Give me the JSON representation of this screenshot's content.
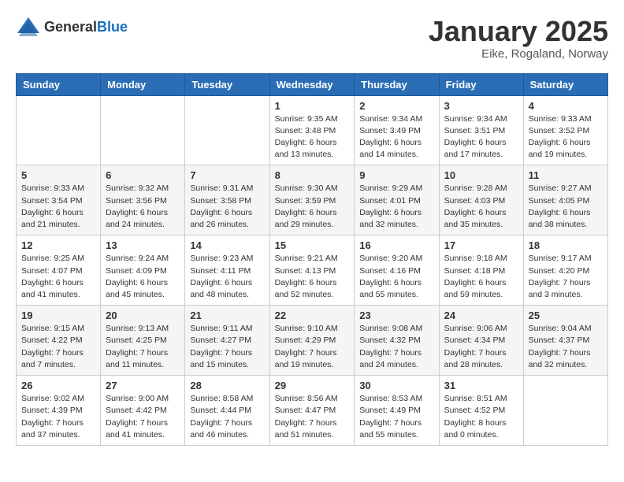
{
  "logo": {
    "general": "General",
    "blue": "Blue"
  },
  "title": {
    "month": "January 2025",
    "location": "Eike, Rogaland, Norway"
  },
  "headers": [
    "Sunday",
    "Monday",
    "Tuesday",
    "Wednesday",
    "Thursday",
    "Friday",
    "Saturday"
  ],
  "weeks": [
    [
      {
        "day": "",
        "info": ""
      },
      {
        "day": "",
        "info": ""
      },
      {
        "day": "",
        "info": ""
      },
      {
        "day": "1",
        "info": "Sunrise: 9:35 AM\nSunset: 3:48 PM\nDaylight: 6 hours\nand 13 minutes."
      },
      {
        "day": "2",
        "info": "Sunrise: 9:34 AM\nSunset: 3:49 PM\nDaylight: 6 hours\nand 14 minutes."
      },
      {
        "day": "3",
        "info": "Sunrise: 9:34 AM\nSunset: 3:51 PM\nDaylight: 6 hours\nand 17 minutes."
      },
      {
        "day": "4",
        "info": "Sunrise: 9:33 AM\nSunset: 3:52 PM\nDaylight: 6 hours\nand 19 minutes."
      }
    ],
    [
      {
        "day": "5",
        "info": "Sunrise: 9:33 AM\nSunset: 3:54 PM\nDaylight: 6 hours\nand 21 minutes."
      },
      {
        "day": "6",
        "info": "Sunrise: 9:32 AM\nSunset: 3:56 PM\nDaylight: 6 hours\nand 24 minutes."
      },
      {
        "day": "7",
        "info": "Sunrise: 9:31 AM\nSunset: 3:58 PM\nDaylight: 6 hours\nand 26 minutes."
      },
      {
        "day": "8",
        "info": "Sunrise: 9:30 AM\nSunset: 3:59 PM\nDaylight: 6 hours\nand 29 minutes."
      },
      {
        "day": "9",
        "info": "Sunrise: 9:29 AM\nSunset: 4:01 PM\nDaylight: 6 hours\nand 32 minutes."
      },
      {
        "day": "10",
        "info": "Sunrise: 9:28 AM\nSunset: 4:03 PM\nDaylight: 6 hours\nand 35 minutes."
      },
      {
        "day": "11",
        "info": "Sunrise: 9:27 AM\nSunset: 4:05 PM\nDaylight: 6 hours\nand 38 minutes."
      }
    ],
    [
      {
        "day": "12",
        "info": "Sunrise: 9:25 AM\nSunset: 4:07 PM\nDaylight: 6 hours\nand 41 minutes."
      },
      {
        "day": "13",
        "info": "Sunrise: 9:24 AM\nSunset: 4:09 PM\nDaylight: 6 hours\nand 45 minutes."
      },
      {
        "day": "14",
        "info": "Sunrise: 9:23 AM\nSunset: 4:11 PM\nDaylight: 6 hours\nand 48 minutes."
      },
      {
        "day": "15",
        "info": "Sunrise: 9:21 AM\nSunset: 4:13 PM\nDaylight: 6 hours\nand 52 minutes."
      },
      {
        "day": "16",
        "info": "Sunrise: 9:20 AM\nSunset: 4:16 PM\nDaylight: 6 hours\nand 55 minutes."
      },
      {
        "day": "17",
        "info": "Sunrise: 9:18 AM\nSunset: 4:18 PM\nDaylight: 6 hours\nand 59 minutes."
      },
      {
        "day": "18",
        "info": "Sunrise: 9:17 AM\nSunset: 4:20 PM\nDaylight: 7 hours\nand 3 minutes."
      }
    ],
    [
      {
        "day": "19",
        "info": "Sunrise: 9:15 AM\nSunset: 4:22 PM\nDaylight: 7 hours\nand 7 minutes."
      },
      {
        "day": "20",
        "info": "Sunrise: 9:13 AM\nSunset: 4:25 PM\nDaylight: 7 hours\nand 11 minutes."
      },
      {
        "day": "21",
        "info": "Sunrise: 9:11 AM\nSunset: 4:27 PM\nDaylight: 7 hours\nand 15 minutes."
      },
      {
        "day": "22",
        "info": "Sunrise: 9:10 AM\nSunset: 4:29 PM\nDaylight: 7 hours\nand 19 minutes."
      },
      {
        "day": "23",
        "info": "Sunrise: 9:08 AM\nSunset: 4:32 PM\nDaylight: 7 hours\nand 24 minutes."
      },
      {
        "day": "24",
        "info": "Sunrise: 9:06 AM\nSunset: 4:34 PM\nDaylight: 7 hours\nand 28 minutes."
      },
      {
        "day": "25",
        "info": "Sunrise: 9:04 AM\nSunset: 4:37 PM\nDaylight: 7 hours\nand 32 minutes."
      }
    ],
    [
      {
        "day": "26",
        "info": "Sunrise: 9:02 AM\nSunset: 4:39 PM\nDaylight: 7 hours\nand 37 minutes."
      },
      {
        "day": "27",
        "info": "Sunrise: 9:00 AM\nSunset: 4:42 PM\nDaylight: 7 hours\nand 41 minutes."
      },
      {
        "day": "28",
        "info": "Sunrise: 8:58 AM\nSunset: 4:44 PM\nDaylight: 7 hours\nand 46 minutes."
      },
      {
        "day": "29",
        "info": "Sunrise: 8:56 AM\nSunset: 4:47 PM\nDaylight: 7 hours\nand 51 minutes."
      },
      {
        "day": "30",
        "info": "Sunrise: 8:53 AM\nSunset: 4:49 PM\nDaylight: 7 hours\nand 55 minutes."
      },
      {
        "day": "31",
        "info": "Sunrise: 8:51 AM\nSunset: 4:52 PM\nDaylight: 8 hours\nand 0 minutes."
      },
      {
        "day": "",
        "info": ""
      }
    ]
  ]
}
